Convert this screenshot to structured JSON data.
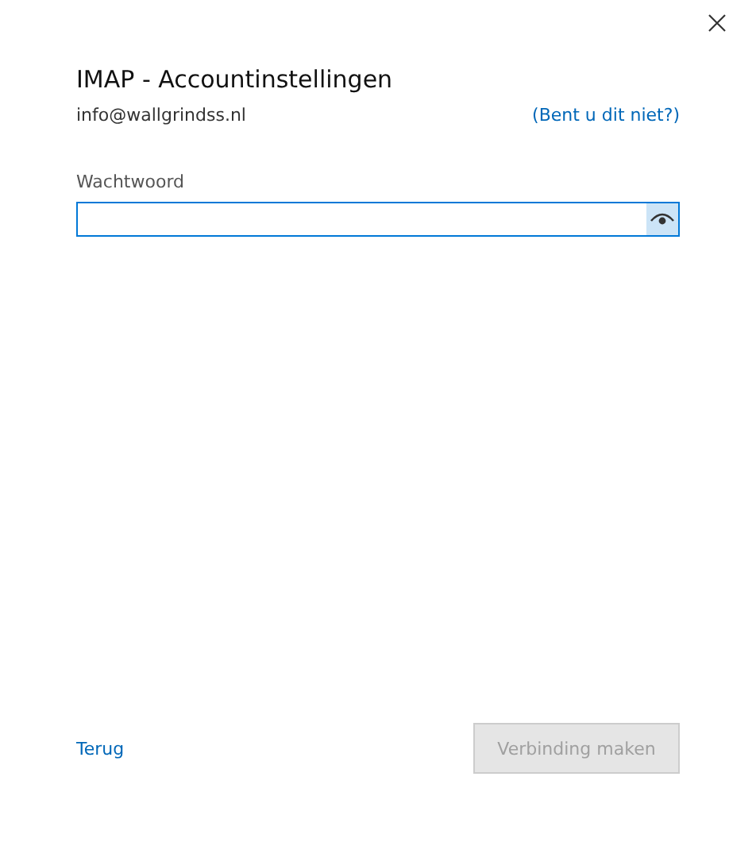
{
  "title": "IMAP - Accountinstellingen",
  "account": {
    "email": "info@wallgrindss.nl",
    "link": "(Bent u dit niet?)"
  },
  "password": {
    "label": "Wachtwoord"
  },
  "footer": {
    "back": "Terug",
    "button": {
      "label": "Verbinding maken",
      "disabled": true
    }
  }
}
